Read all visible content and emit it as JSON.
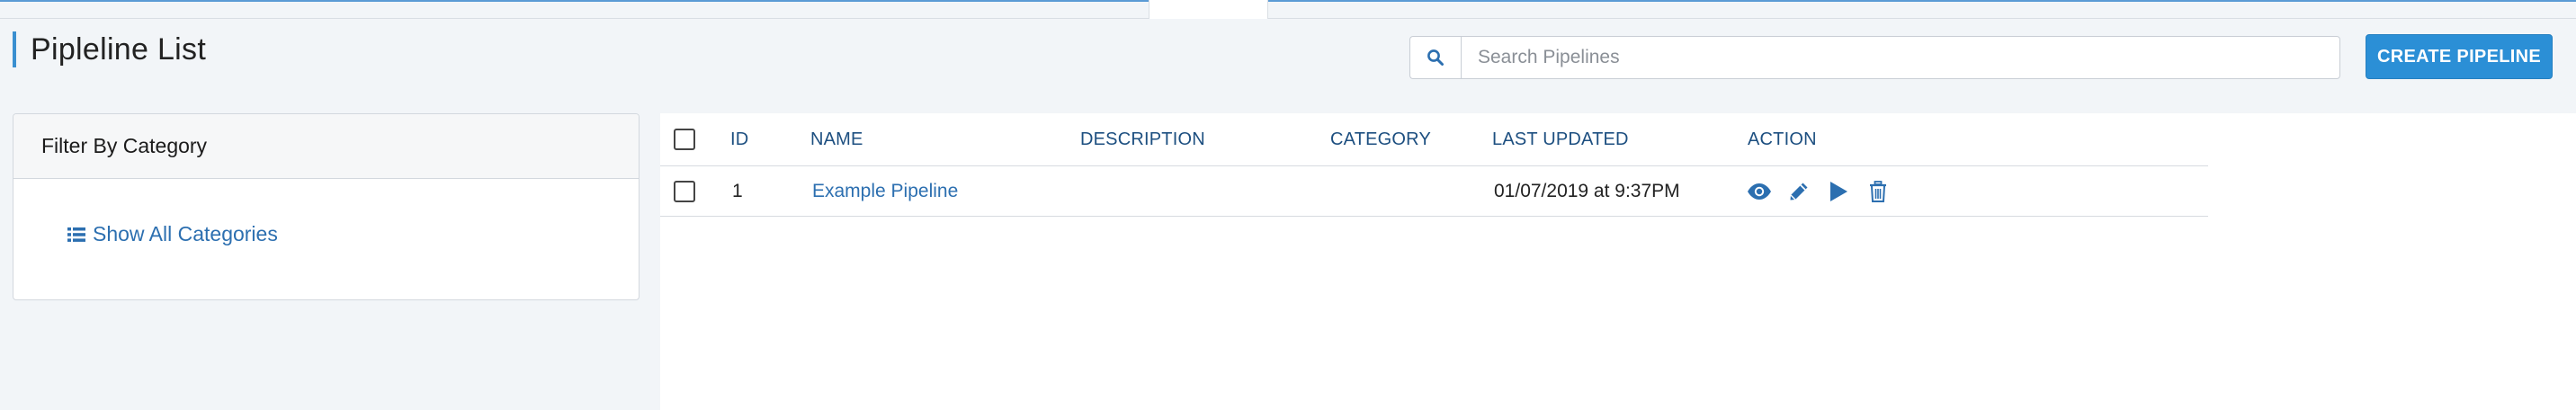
{
  "page": {
    "title": "Pipleline List"
  },
  "search": {
    "icon": "search-icon",
    "placeholder": "Search Pipelines",
    "value": ""
  },
  "toolbar": {
    "create_label": "CREATE PIPELINE"
  },
  "filter": {
    "header": "Filter By Category",
    "show_all_label": "Show All Categories",
    "show_all_icon": "list-icon"
  },
  "table": {
    "columns": [
      "ID",
      "NAME",
      "DESCRIPTION",
      "CATEGORY",
      "LAST UPDATED",
      "ACTION"
    ],
    "rows": [
      {
        "id": "1",
        "name": "Example Pipeline",
        "description": "",
        "category": "",
        "last_updated": "01/07/2019 at 9:37PM",
        "actions": [
          "view-icon",
          "edit-icon",
          "run-icon",
          "delete-icon"
        ]
      }
    ]
  },
  "colors": {
    "accent": "#2b8fd6",
    "link": "#2c6fb0",
    "header_text": "#1d4f80",
    "background": "#f2f5f8"
  }
}
